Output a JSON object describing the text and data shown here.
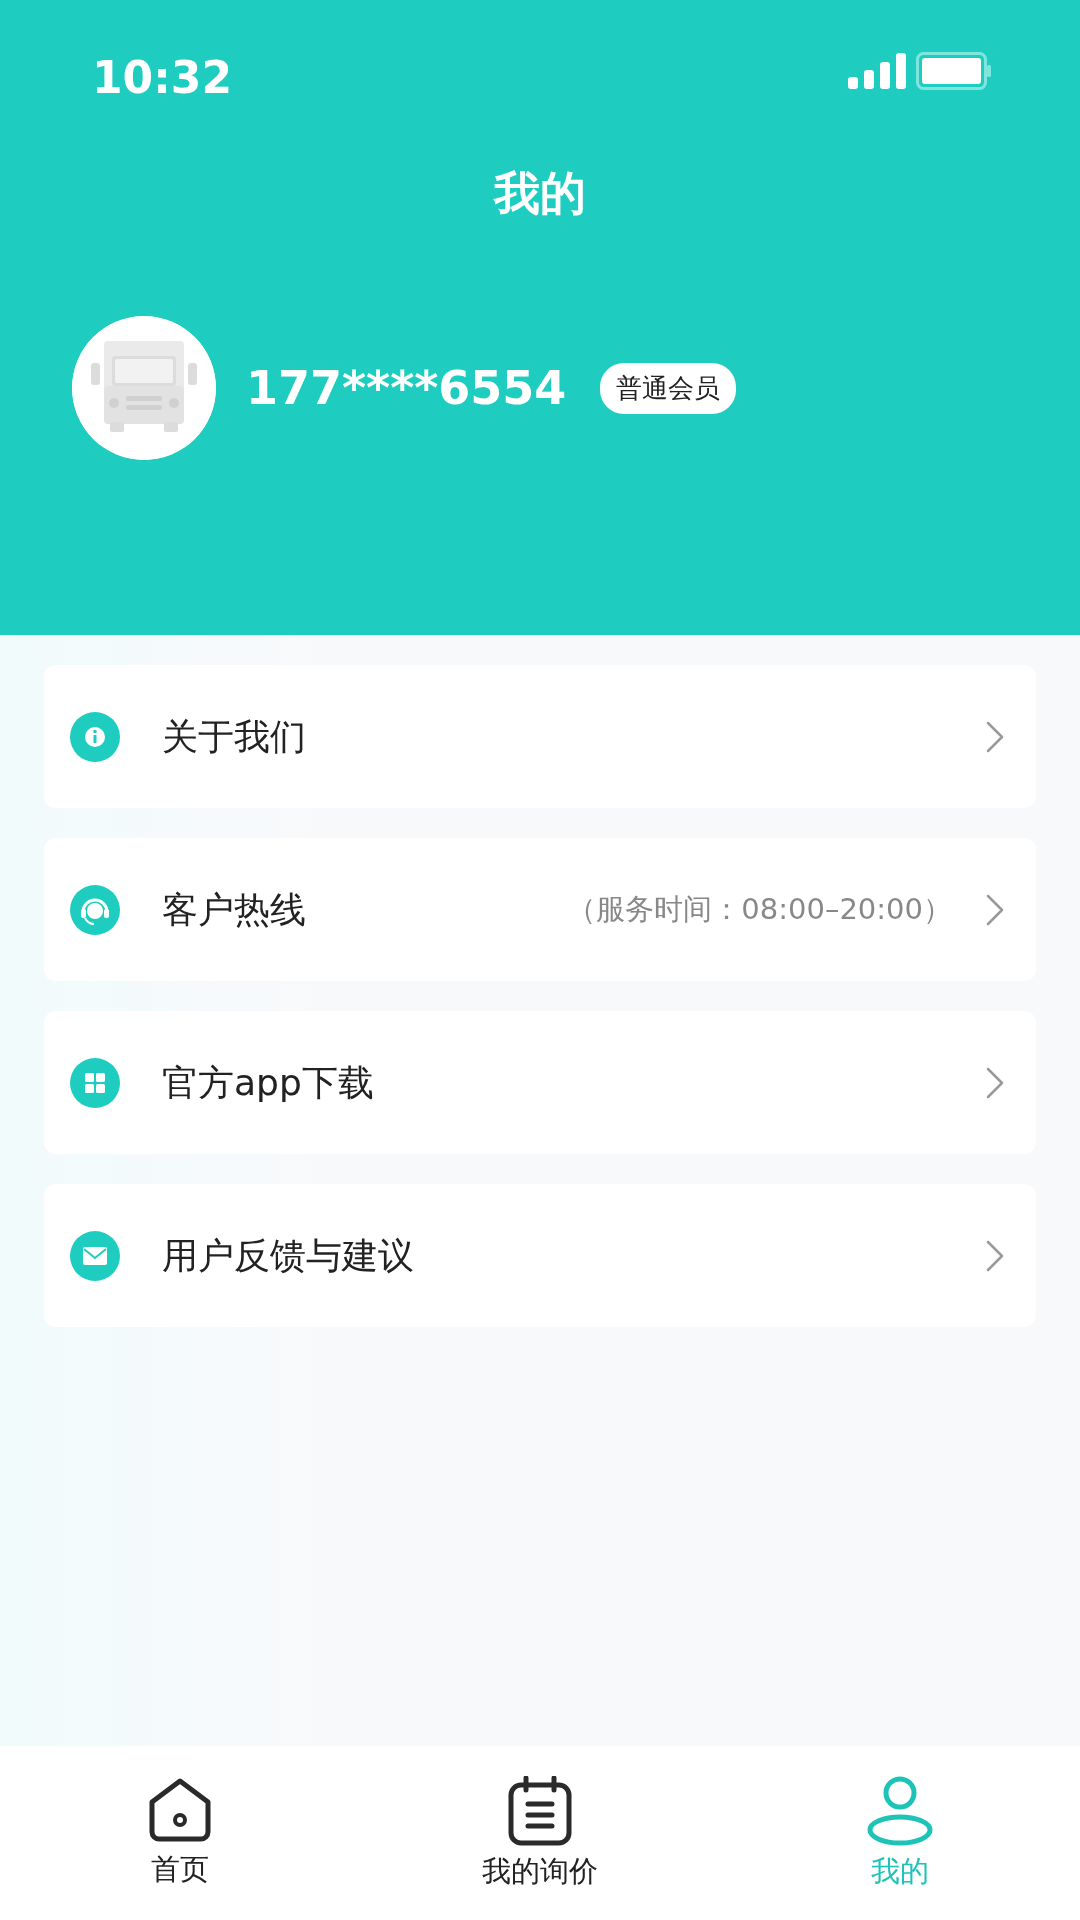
{
  "status_bar": {
    "time": "10:32"
  },
  "header": {
    "title": "我的"
  },
  "profile": {
    "phone": "177****6554",
    "badge": "普通会员"
  },
  "menu": [
    {
      "kind": "info",
      "label": "关于我们"
    },
    {
      "kind": "headset",
      "label": "客户热线",
      "note": "（服务时间：08:00–20:00）"
    },
    {
      "kind": "grid",
      "label": "官方app下载"
    },
    {
      "kind": "mail",
      "label": "用户反馈与建议"
    }
  ],
  "tab_bar": [
    {
      "kind": "home",
      "label": "首页",
      "selected": false
    },
    {
      "kind": "list",
      "label": "我的询价",
      "selected": false
    },
    {
      "kind": "person",
      "label": "我的",
      "selected": true
    }
  ]
}
